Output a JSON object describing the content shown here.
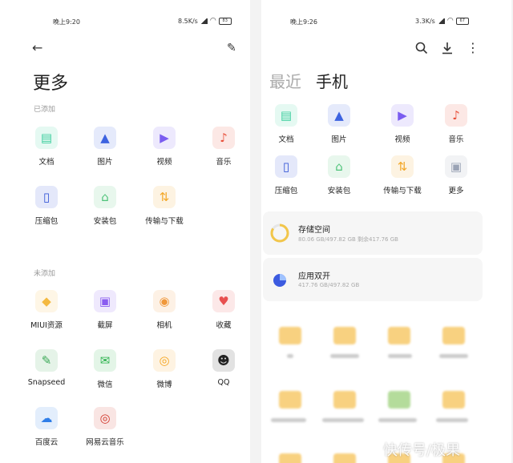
{
  "left": {
    "status": {
      "time": "晚上9:20",
      "speed": "8.5K/s",
      "battery": "83"
    },
    "title": "更多",
    "added_label": "已添加",
    "added": [
      {
        "label": "文档",
        "icon": "document-icon",
        "color": "#3fcf9f"
      },
      {
        "label": "图片",
        "icon": "image-icon",
        "color": "#3d63e0"
      },
      {
        "label": "视频",
        "icon": "video-icon",
        "color": "#7a5cf0"
      },
      {
        "label": "音乐",
        "icon": "music-icon",
        "color": "#e8503a"
      },
      {
        "label": "压缩包",
        "icon": "archive-icon",
        "color": "#3556d6"
      },
      {
        "label": "安装包",
        "icon": "apk-icon",
        "color": "#4fc37a"
      },
      {
        "label": "传输与下载",
        "icon": "transfer-icon",
        "color": "#f3a728"
      }
    ],
    "not_added_label": "未添加",
    "not_added": [
      {
        "label": "MIUI资源",
        "icon": "miui-resource-icon",
        "color": "#f4b940"
      },
      {
        "label": "截屏",
        "icon": "screenshot-icon",
        "color": "#8a5cf0"
      },
      {
        "label": "相机",
        "icon": "camera-icon",
        "color": "#f0983a"
      },
      {
        "label": "收藏",
        "icon": "favorite-icon",
        "color": "#e85050"
      },
      {
        "label": "Snapseed",
        "icon": "snapseed-icon",
        "color": "#3aa856"
      },
      {
        "label": "微信",
        "icon": "wechat-icon",
        "color": "#2bb24c"
      },
      {
        "label": "微博",
        "icon": "weibo-icon",
        "color": "#f5a623"
      },
      {
        "label": "QQ",
        "icon": "qq-icon",
        "color": "#222222"
      },
      {
        "label": "百度云",
        "icon": "baidu-cloud-icon",
        "color": "#2f7ee8"
      },
      {
        "label": "网易云音乐",
        "icon": "netease-music-icon",
        "color": "#d23b2f"
      }
    ]
  },
  "right": {
    "status": {
      "time": "晚上9:26",
      "speed": "3.3K/s",
      "battery": "67"
    },
    "tabs": [
      "最近",
      "手机"
    ],
    "grid": [
      {
        "label": "文档",
        "icon": "document-icon",
        "color": "#3fcf9f"
      },
      {
        "label": "图片",
        "icon": "image-icon",
        "color": "#3d63e0"
      },
      {
        "label": "视频",
        "icon": "video-icon",
        "color": "#7a5cf0"
      },
      {
        "label": "音乐",
        "icon": "music-icon",
        "color": "#e8503a"
      },
      {
        "label": "压缩包",
        "icon": "archive-icon",
        "color": "#3556d6"
      },
      {
        "label": "安装包",
        "icon": "apk-icon",
        "color": "#4fc37a"
      },
      {
        "label": "传输与下载",
        "icon": "transfer-icon",
        "color": "#f3a728"
      },
      {
        "label": "更多",
        "icon": "more-icon",
        "color": "#9aa3b5"
      }
    ],
    "storage": {
      "title": "存储空间",
      "detail": "80.06 GB/497.82 GB  剩余417.76 GB",
      "fraction": 0.16
    },
    "dual_app": {
      "title": "应用双开",
      "detail": "417.76 GB/497.82 GB"
    }
  },
  "watermark": "快传号/极果"
}
